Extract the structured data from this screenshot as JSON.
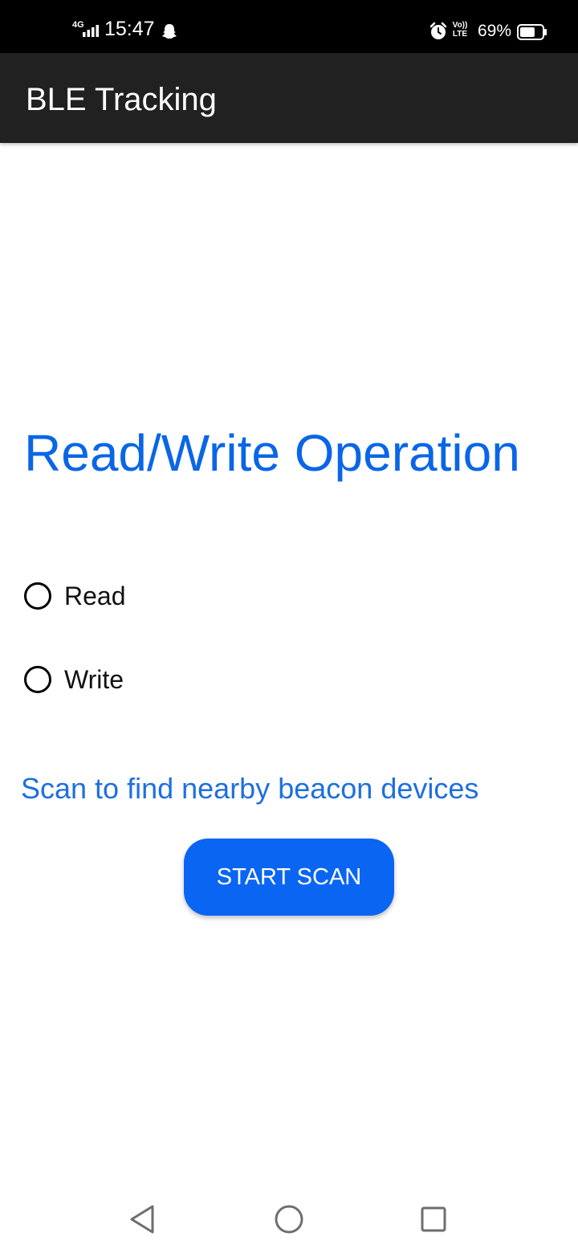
{
  "status_bar": {
    "network": "4G",
    "time": "15:47",
    "volte_top": "Vo))",
    "volte_bottom": "LTE",
    "battery_percent": "69%",
    "battery_level": 0.69,
    "icons": [
      "signal-icon",
      "ghost-icon",
      "alarm-icon",
      "volte-icon",
      "battery-icon"
    ]
  },
  "app_bar": {
    "title": "BLE Tracking",
    "background": "#212121"
  },
  "main": {
    "heading": "Read/Write Operation",
    "heading_color": "#0a66e6",
    "radio_options": [
      {
        "label": "Read",
        "selected": false
      },
      {
        "label": "Write",
        "selected": false
      }
    ],
    "scan_hint": "Scan to find nearby beacon devices",
    "scan_button_label": "START SCAN",
    "button_color": "#0a66f2"
  },
  "nav_bar": {
    "icons": [
      "back-icon",
      "home-icon",
      "recents-icon"
    ]
  }
}
